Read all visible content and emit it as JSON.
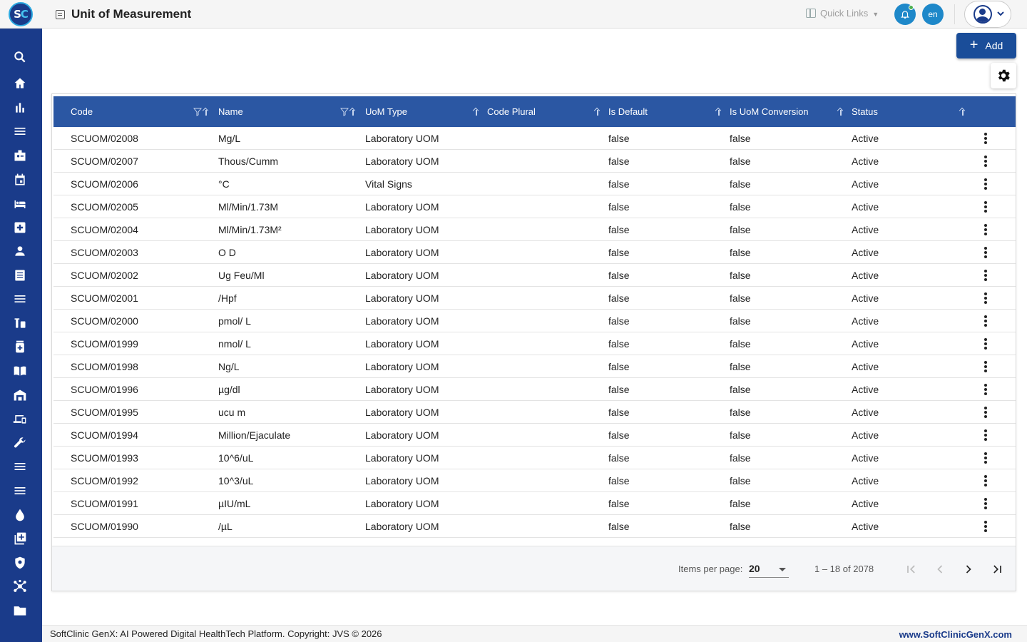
{
  "header": {
    "logo_text_s": "S",
    "logo_text_c": "C",
    "title": "Unit of Measurement",
    "quick_links": "Quick Links",
    "language": "en"
  },
  "sidebar": {
    "items": [
      "search-icon",
      "home-icon",
      "bar-chart-icon",
      "menu-icon",
      "badge-icon",
      "calendar-icon",
      "bed-icon",
      "medical-plus-icon",
      "person-icon",
      "document-list-icon",
      "menu-icon",
      "medicine-icon",
      "pill-bottle-icon",
      "book-icon",
      "warehouse-icon",
      "devices-icon",
      "wrench-icon",
      "menu-icon",
      "menu-icon",
      "drop-icon",
      "add-box-icon",
      "shield-icon",
      "hub-icon",
      "folder-icon"
    ]
  },
  "toolbar": {
    "add_label": "Add"
  },
  "table": {
    "columns": [
      "Code",
      "Name",
      "UoM Type",
      "Code Plural",
      "Is Default",
      "Is UoM Conversion",
      "Status"
    ],
    "rows": [
      [
        "SCUOM/02008",
        "Mg/L",
        "Laboratory UOM",
        "",
        "false",
        "false",
        "Active"
      ],
      [
        "SCUOM/02007",
        "Thous/Cumm",
        "Laboratory UOM",
        "",
        "false",
        "false",
        "Active"
      ],
      [
        "SCUOM/02006",
        "°C",
        "Vital Signs",
        "",
        "false",
        "false",
        "Active"
      ],
      [
        "SCUOM/02005",
        "Ml/Min/1.73M",
        "Laboratory UOM",
        "",
        "false",
        "false",
        "Active"
      ],
      [
        "SCUOM/02004",
        "Ml/Min/1.73M²",
        "Laboratory UOM",
        "",
        "false",
        "false",
        "Active"
      ],
      [
        "SCUOM/02003",
        "O D",
        "Laboratory UOM",
        "",
        "false",
        "false",
        "Active"
      ],
      [
        "SCUOM/02002",
        "Ug Feu/Ml",
        "Laboratory UOM",
        "",
        "false",
        "false",
        "Active"
      ],
      [
        "SCUOM/02001",
        "/Hpf",
        "Laboratory UOM",
        "",
        "false",
        "false",
        "Active"
      ],
      [
        "SCUOM/02000",
        "pmol/ L",
        "Laboratory UOM",
        "",
        "false",
        "false",
        "Active"
      ],
      [
        "SCUOM/01999",
        "nmol/ L",
        "Laboratory UOM",
        "",
        "false",
        "false",
        "Active"
      ],
      [
        "SCUOM/01998",
        "Ng/L",
        "Laboratory UOM",
        "",
        "false",
        "false",
        "Active"
      ],
      [
        "SCUOM/01996",
        "µg/dl",
        "Laboratory UOM",
        "",
        "false",
        "false",
        "Active"
      ],
      [
        "SCUOM/01995",
        "ucu m",
        "Laboratory UOM",
        "",
        "false",
        "false",
        "Active"
      ],
      [
        "SCUOM/01994",
        "Million/Ejaculate",
        "Laboratory UOM",
        "",
        "false",
        "false",
        "Active"
      ],
      [
        "SCUOM/01993",
        "10^6/uL",
        "Laboratory UOM",
        "",
        "false",
        "false",
        "Active"
      ],
      [
        "SCUOM/01992",
        "10^3/uL",
        "Laboratory UOM",
        "",
        "false",
        "false",
        "Active"
      ],
      [
        "SCUOM/01991",
        "µIU/mL",
        "Laboratory UOM",
        "",
        "false",
        "false",
        "Active"
      ],
      [
        "SCUOM/01990",
        "/µL",
        "Laboratory UOM",
        "",
        "false",
        "false",
        "Active"
      ]
    ]
  },
  "pagination": {
    "items_per_page_label": "Items per page:",
    "items_per_page_value": "20",
    "range_label": "1 – 18 of 2078"
  },
  "footer": {
    "copyright": "SoftClinic GenX: AI Powered Digital HealthTech Platform. Copyright: JVS © 2026",
    "website": "www.SoftClinicGenX.com"
  },
  "colors": {
    "sidebar": "#1a3b8a",
    "table_header": "#2b57a3",
    "accent": "#1e88c9"
  }
}
